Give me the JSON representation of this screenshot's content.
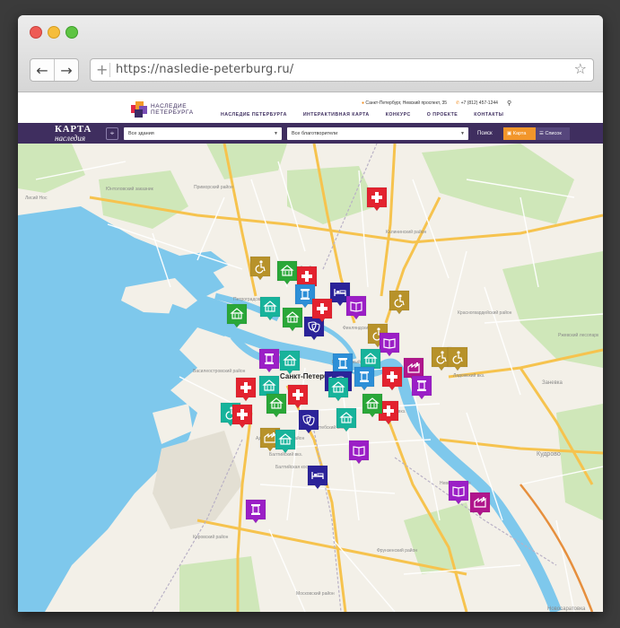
{
  "browser": {
    "url": "https://nasledie-peterburg.ru/"
  },
  "site": {
    "logo_line1": "НАСЛЕДИЕ",
    "logo_line2": "ПЕТЕРБУРГА",
    "address": "Санкт-Петербург, Невский проспект, 35",
    "phone": "+7 (812) 457-1244",
    "nav": [
      "НАСЛЕДИЕ ПЕТЕРБУРГА",
      "ИНТЕРАКТИВНАЯ КАРТА",
      "КОНКУРС",
      "О ПРОЕКТЕ",
      "КОНТАКТЫ"
    ]
  },
  "filters": {
    "brand_line1": "КАРТА",
    "brand_line2": "наследия",
    "buildings_select": "Все здания",
    "donors_select": "Все благотворители",
    "search_label": "Поиск",
    "view_map": "Карта",
    "view_list": "Список"
  },
  "map": {
    "center_label": "Санкт-Петербург",
    "labels": [
      "Юнтоловский заказник",
      "Приморский район",
      "Выборгский район",
      "Калининский район",
      "Петроградский район",
      "Василеостровский район",
      "Красногвардейский район",
      "Адмиралтейский район",
      "Центральный район",
      "Кировский район",
      "Фрунзенский район",
      "Невский район",
      "Московский район",
      "Ржевский лесопарк",
      "Кудрово",
      "Заневка",
      "Новосаратовка",
      "Балтийская коса",
      "Ладожский вкз.",
      "Финляндский вкз.",
      "Московский вкз.",
      "Балтийский вкз.",
      "Витебский вкз.",
      "Лисий Нос"
    ],
    "marker_colors": {
      "green": "#2aa738",
      "teal": "#17b39b",
      "red": "#e3232f",
      "purple": "#9b1fc6",
      "navy": "#2b2399",
      "ochre": "#b7922a",
      "blue": "#2d8fd7",
      "magenta": "#b0168c"
    },
    "markers": [
      {
        "type": "medical",
        "color": "red"
      },
      {
        "type": "accessibility",
        "color": "ochre"
      },
      {
        "type": "building",
        "color": "green"
      },
      {
        "type": "medical",
        "color": "red"
      },
      {
        "type": "column",
        "color": "blue"
      },
      {
        "type": "bed",
        "color": "navy"
      },
      {
        "type": "book",
        "color": "purple"
      },
      {
        "type": "accessibility",
        "color": "ochre"
      },
      {
        "type": "building",
        "color": "green"
      },
      {
        "type": "building",
        "color": "teal"
      },
      {
        "type": "building",
        "color": "green"
      },
      {
        "type": "theatre",
        "color": "navy"
      },
      {
        "type": "medical",
        "color": "red"
      },
      {
        "type": "accessibility",
        "color": "ochre"
      },
      {
        "type": "book",
        "color": "purple"
      },
      {
        "type": "column",
        "color": "purple"
      },
      {
        "type": "building",
        "color": "teal"
      },
      {
        "type": "accessibility",
        "color": "ochre"
      },
      {
        "type": "accessibility",
        "color": "ochre"
      },
      {
        "type": "factory",
        "color": "magenta"
      },
      {
        "type": "column",
        "color": "blue"
      },
      {
        "type": "building",
        "color": "teal"
      },
      {
        "type": "medical",
        "color": "red"
      },
      {
        "type": "column",
        "color": "purple"
      },
      {
        "type": "medical",
        "color": "red"
      },
      {
        "type": "building",
        "color": "teal"
      },
      {
        "type": "theatre",
        "color": "navy"
      },
      {
        "type": "building",
        "color": "green"
      },
      {
        "type": "medical",
        "color": "red"
      },
      {
        "type": "accessibility",
        "color": "teal"
      },
      {
        "type": "theatre",
        "color": "navy"
      },
      {
        "type": "column",
        "color": "blue"
      },
      {
        "type": "factory",
        "color": "ochre"
      },
      {
        "type": "building",
        "color": "teal"
      },
      {
        "type": "theatre",
        "color": "navy"
      },
      {
        "type": "medical",
        "color": "red"
      },
      {
        "type": "building",
        "color": "teal"
      },
      {
        "type": "book",
        "color": "purple"
      },
      {
        "type": "bed",
        "color": "navy"
      },
      {
        "type": "column",
        "color": "purple"
      },
      {
        "type": "book",
        "color": "purple"
      },
      {
        "type": "factory",
        "color": "magenta"
      },
      {
        "type": "building",
        "color": "green"
      },
      {
        "type": "medical",
        "color": "red"
      },
      {
        "type": "building",
        "color": "teal"
      }
    ]
  }
}
